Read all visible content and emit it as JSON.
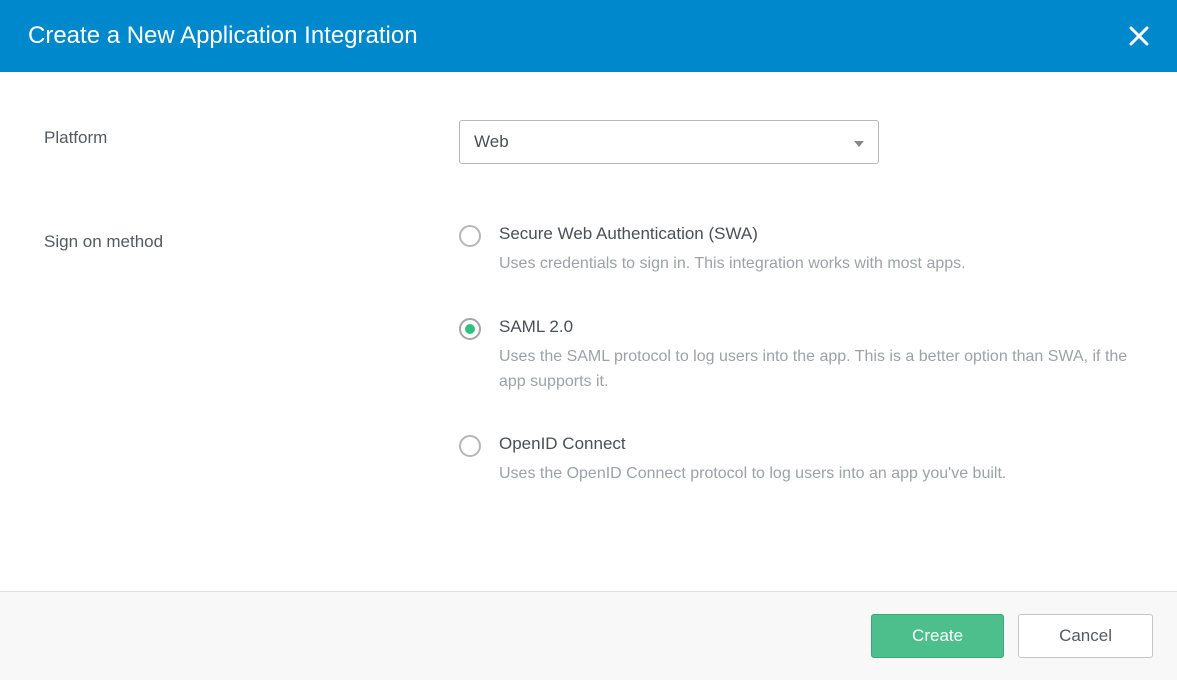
{
  "dialog": {
    "title": "Create a New Application Integration"
  },
  "form": {
    "platform": {
      "label": "Platform",
      "selected": "Web"
    },
    "signOnMethod": {
      "label": "Sign on method",
      "options": [
        {
          "value": "swa",
          "label": "Secure Web Authentication (SWA)",
          "description": "Uses credentials to sign in. This integration works with most apps.",
          "selected": false
        },
        {
          "value": "saml",
          "label": "SAML 2.0",
          "description": "Uses the SAML protocol to log users into the app. This is a better option than SWA, if the app supports it.",
          "selected": true
        },
        {
          "value": "oidc",
          "label": "OpenID Connect",
          "description": "Uses the OpenID Connect protocol to log users into an app you've built.",
          "selected": false
        }
      ]
    }
  },
  "footer": {
    "create": "Create",
    "cancel": "Cancel"
  }
}
